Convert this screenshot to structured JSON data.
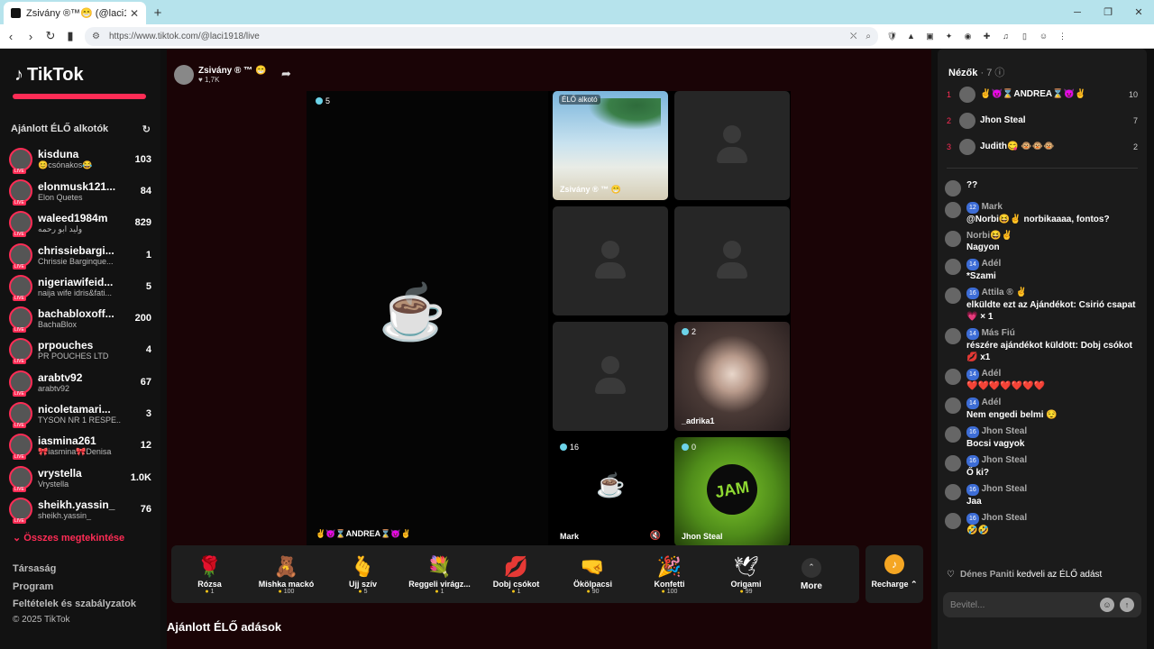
{
  "browser": {
    "tab_title": "Zsivány ®™😁 (@laci1918) ÉL",
    "url": "https://www.tiktok.com/@laci1918/live"
  },
  "brand": {
    "name": "TikTok",
    "accent": "#fe2c55"
  },
  "sidebar": {
    "heading": "Ajánlott ÉLŐ alkotók",
    "see_all": "Összes megtekintése",
    "creators": [
      {
        "name": "kisduna",
        "sub": "😊csónakos😂",
        "count": "103"
      },
      {
        "name": "elonmusk121...",
        "sub": "Elon Quetes",
        "count": "84"
      },
      {
        "name": "waleed1984m",
        "sub": "وليد ابو رحمه",
        "count": "829"
      },
      {
        "name": "chrissiebargi...",
        "sub": "Chrissie Barginque...",
        "count": "1"
      },
      {
        "name": "nigeriawifeid...",
        "sub": "naija wife idris&fati...",
        "count": "5"
      },
      {
        "name": "bachabloxoff...",
        "sub": "BachaBlox",
        "count": "200"
      },
      {
        "name": "prpouches",
        "sub": "PR POUCHES LTD",
        "count": "4"
      },
      {
        "name": "arabtv92",
        "sub": "arabtv92",
        "count": "67"
      },
      {
        "name": "nicoletamari...",
        "sub": "TYSON NR 1 RESPE...",
        "count": "3"
      },
      {
        "name": "iasmina261",
        "sub": "🎀iasmina🎀Denisa",
        "count": "12"
      },
      {
        "name": "vrystella",
        "sub": "Vrystella",
        "count": "1.0K"
      },
      {
        "name": "sheikh.yassin_",
        "sub": "sheikh.yassin_",
        "count": "76"
      }
    ],
    "footer": [
      "Társaság",
      "Program",
      "Feltételek és szabályzatok",
      "© 2025 TikTok"
    ]
  },
  "stream": {
    "host": "Zsivány ® ™ 😁",
    "likes": "♥ 1,7K",
    "main_count": "5",
    "main_label": "✌😈⌛ANDREA⌛😈✌",
    "tiles": [
      {
        "label": "Zsivány ® ™ 😁",
        "tag": "ÉLŐ alkotó",
        "count": ""
      },
      {
        "label": "",
        "tag": "",
        "count": ""
      },
      {
        "label": "",
        "tag": "",
        "count": ""
      },
      {
        "label": "",
        "tag": "",
        "count": ""
      },
      {
        "label": "",
        "tag": "",
        "count": ""
      },
      {
        "label": "_adrika1",
        "tag": "",
        "count": "2"
      },
      {
        "label": "Mark",
        "tag": "",
        "count": "16"
      },
      {
        "label": "Jhon Steal",
        "tag": "",
        "count": "0"
      }
    ]
  },
  "gifts": [
    {
      "name": "Rózsa",
      "price": "1",
      "icon": "🌹"
    },
    {
      "name": "Mishka mackó",
      "price": "100",
      "icon": "🧸"
    },
    {
      "name": "Ujj szív",
      "price": "5",
      "icon": "🫰"
    },
    {
      "name": "Reggeli virágz...",
      "price": "1",
      "icon": "💐"
    },
    {
      "name": "Dobj csókot",
      "price": "1",
      "icon": "💋"
    },
    {
      "name": "Ökölpacsi",
      "price": "90",
      "icon": "🤜"
    },
    {
      "name": "Konfetti",
      "price": "100",
      "icon": "🎉"
    },
    {
      "name": "Origami",
      "price": "99",
      "icon": "🕊"
    }
  ],
  "more_label": "More",
  "recharge_label": "Recharge ⌃",
  "bottom_heading": "Ajánlott ÉLŐ adások",
  "chat": {
    "viewers_title": "Nézők",
    "viewers_count": "· 7",
    "viewers": [
      {
        "rank": "1",
        "name": "✌😈⌛ANDREA⌛😈✌",
        "score": "10"
      },
      {
        "rank": "2",
        "name": "Jhon Steal",
        "score": "7"
      },
      {
        "rank": "3",
        "name": "Judith😋 🐵🐵🐵",
        "score": "2"
      }
    ],
    "messages": [
      {
        "user": "",
        "level": "",
        "text": "??"
      },
      {
        "user": "Mark",
        "level": "12",
        "text": "@Norbi😆✌ norbikaaaa, fontos?"
      },
      {
        "user": "Norbi😆✌",
        "level": "",
        "text": "Nagyon"
      },
      {
        "user": "Adél",
        "level": "14",
        "text": "*Szami"
      },
      {
        "user": "Attila ® ✌",
        "level": "16",
        "text": "elküldte ezt az Ajándékot: Csirió csapat💗 × 1"
      },
      {
        "user": "Más Fiú",
        "level": "14",
        "text": "részére ajándékot küldött: Dobj csókot 💋 x1"
      },
      {
        "user": "Adél",
        "level": "14",
        "text": "❤️❤️❤️❤️❤️❤️❤️"
      },
      {
        "user": "Adél",
        "level": "14",
        "text": "Nem engedi belmi 😌"
      },
      {
        "user": "Jhon Steal",
        "level": "16",
        "text": "Bocsi vagyok"
      },
      {
        "user": "Jhon Steal",
        "level": "16",
        "text": "Ő ki?"
      },
      {
        "user": "Jhon Steal",
        "level": "16",
        "text": "Jaa"
      },
      {
        "user": "Jhon Steal",
        "level": "16",
        "text": "🤣🤣"
      }
    ],
    "like_user": "Dénes Paniti",
    "like_text": "kedveli az ÉLŐ adást",
    "input_placeholder": "Bevitel..."
  }
}
